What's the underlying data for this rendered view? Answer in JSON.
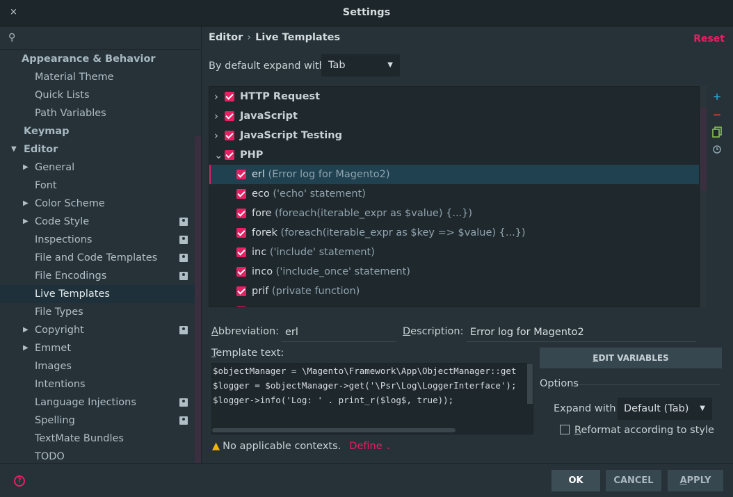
{
  "window": {
    "title": "Settings",
    "close_glyph": "×"
  },
  "sidebar": {
    "search_icon": "search-icon",
    "items": [
      {
        "label": "Appearance & Behavior",
        "type": "group"
      },
      {
        "label": "Material Theme"
      },
      {
        "label": "Quick Lists"
      },
      {
        "label": "Path Variables"
      },
      {
        "label": "Keymap",
        "type": "group"
      },
      {
        "label": "Editor",
        "type": "group",
        "expanded": true
      },
      {
        "label": "General",
        "collapsible": true
      },
      {
        "label": "Font"
      },
      {
        "label": "Color Scheme",
        "collapsible": true
      },
      {
        "label": "Code Style",
        "collapsible": true,
        "project": true
      },
      {
        "label": "Inspections",
        "project": true
      },
      {
        "label": "File and Code Templates",
        "project": true
      },
      {
        "label": "File Encodings",
        "project": true
      },
      {
        "label": "Live Templates",
        "selected": true
      },
      {
        "label": "File Types"
      },
      {
        "label": "Copyright",
        "collapsible": true,
        "project": true
      },
      {
        "label": "Emmet",
        "collapsible": true
      },
      {
        "label": "Images"
      },
      {
        "label": "Intentions"
      },
      {
        "label": "Language Injections",
        "project": true
      },
      {
        "label": "Spelling",
        "project": true
      },
      {
        "label": "TextMate Bundles"
      },
      {
        "label": "TODO"
      }
    ]
  },
  "breadcrumb": {
    "parent": "Editor",
    "sep": "›",
    "current": "Live Templates"
  },
  "reset_label": "Reset",
  "expand_default": {
    "label": "By default expand with",
    "value": "Tab"
  },
  "template_groups": [
    {
      "name": "HTTP Request",
      "expanded": false
    },
    {
      "name": "JavaScript",
      "expanded": false
    },
    {
      "name": "JavaScript Testing",
      "expanded": false
    },
    {
      "name": "PHP",
      "expanded": true
    }
  ],
  "templates": [
    {
      "abbr": "erl",
      "desc": "(Error log for Magento2)",
      "selected": true
    },
    {
      "abbr": "eco",
      "desc": "('echo' statement)"
    },
    {
      "abbr": "fore",
      "desc": "(foreach(iterable_expr as $value) {...})"
    },
    {
      "abbr": "forek",
      "desc": "(foreach(iterable_expr as $key => $value) {...})"
    },
    {
      "abbr": "inc",
      "desc": "('include' statement)"
    },
    {
      "abbr": "inco",
      "desc": "('include_once' statement)"
    },
    {
      "abbr": "prif",
      "desc": "(private function)"
    }
  ],
  "toolbar": {
    "add": "+",
    "remove": "−",
    "copy": "copy-icon",
    "restore": "restore-icon"
  },
  "abbreviation": {
    "label": "Abbreviation:",
    "value": "erl"
  },
  "description": {
    "label": "Description:",
    "value": "Error log for Magento2"
  },
  "template_text": {
    "label": "Template text:",
    "lines": [
      "$objectManager = \\Magento\\Framework\\App\\ObjectManager::get",
      "$logger = $objectManager->get('\\Psr\\Log\\LoggerInterface');",
      "$logger->info('Log: ' . print_r($log$, true));"
    ]
  },
  "edit_variables_label": "EDIT VARIABLES",
  "options": {
    "label": "Options",
    "expand_with_label": "Expand with",
    "expand_with_value": "Default (Tab)",
    "reformat_label": "Reformat according to style",
    "reformat_checked": false
  },
  "contexts": {
    "warning": "No applicable contexts.",
    "define": "Define"
  },
  "buttons": {
    "ok": "OK",
    "cancel": "CANCEL",
    "apply": "APPLY"
  },
  "colors": {
    "accent": "#e91e63",
    "background": "#263238",
    "selection": "#1f4150"
  }
}
